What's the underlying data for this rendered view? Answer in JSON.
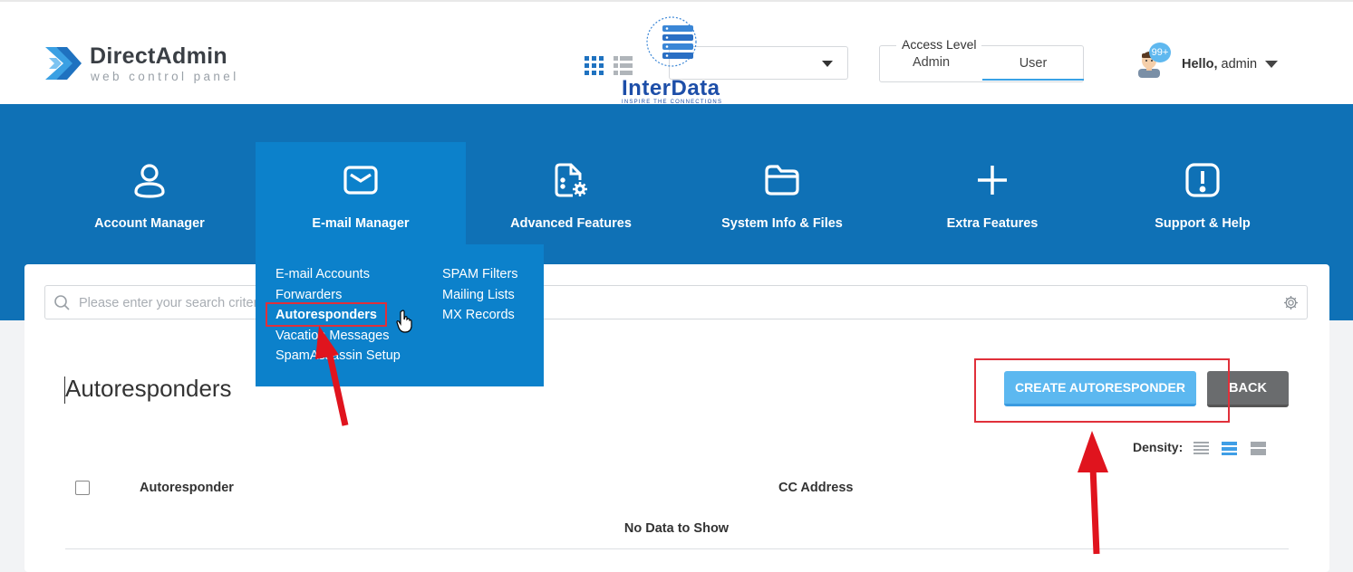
{
  "header": {
    "logo_title": "DirectAdmin",
    "logo_subtitle": "web control panel",
    "access": {
      "label": "Access Level",
      "options": [
        "Admin",
        "User"
      ],
      "selected": "User"
    },
    "user": {
      "greeting": "Hello,",
      "name": "admin",
      "badge": "99+"
    }
  },
  "watermark": {
    "brand": "InterData",
    "tagline": "INSPIRE THE CONNECTIONS"
  },
  "nav": {
    "items": [
      {
        "label": "Account Manager",
        "icon": "user-icon"
      },
      {
        "label": "E-mail Manager",
        "icon": "envelope-icon",
        "active": true
      },
      {
        "label": "Advanced Features",
        "icon": "document-gear-icon"
      },
      {
        "label": "System Info & Files",
        "icon": "folder-icon"
      },
      {
        "label": "Extra Features",
        "icon": "plus-icon"
      },
      {
        "label": "Support & Help",
        "icon": "exclamation-icon"
      }
    ]
  },
  "email_menu": {
    "col1": [
      "E-mail Accounts",
      "Forwarders",
      "Autoresponders",
      "Vacation Messages",
      "SpamAssassin Setup"
    ],
    "col2": [
      "SPAM Filters",
      "Mailing Lists",
      "MX Records"
    ],
    "highlighted": "Autoresponders"
  },
  "search": {
    "placeholder": "Please enter your search criteria"
  },
  "page": {
    "title": "Autoresponders",
    "create_button": "CREATE AUTORESPONDER",
    "back_button": "BACK",
    "density_label": "Density:",
    "density_selected": "medium"
  },
  "table": {
    "columns": [
      "Autoresponder",
      "CC Address"
    ],
    "empty_message": "No Data to Show"
  },
  "colors": {
    "primary_band": "#0f71b6",
    "active_tab": "#0c81cb",
    "accent": "#5cb8f0",
    "annotation": "#e0303a"
  }
}
